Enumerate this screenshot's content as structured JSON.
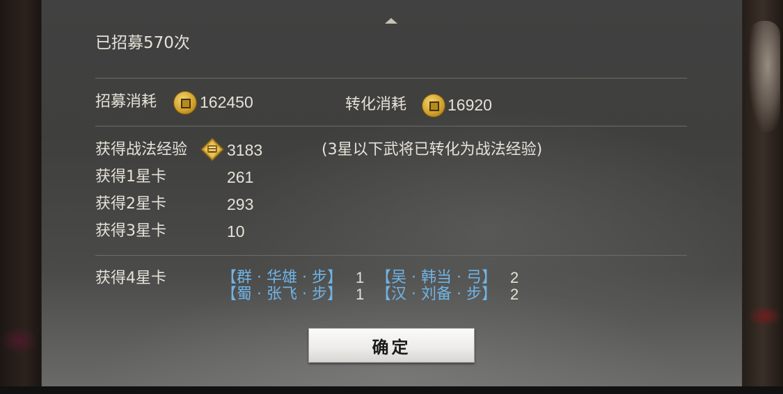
{
  "title": "已招募570次",
  "costs": {
    "recruit_label": "招募消耗",
    "recruit_value": "162450",
    "convert_label": "转化消耗",
    "convert_value": "16920",
    "currency_icon": "copper-coin-icon"
  },
  "rewards": {
    "exp_label": "获得战法经验",
    "exp_value": "3183",
    "exp_icon": "tactic-exp-icon",
    "exp_note": "(3星以下武将已转化为战法经验)",
    "star1_label": "获得1星卡",
    "star1_value": "261",
    "star2_label": "获得2星卡",
    "star2_value": "293",
    "star3_label": "获得3星卡",
    "star3_value": "10",
    "star4_label": "获得4星卡",
    "star4_cards": [
      {
        "name": "【群 · 华雄 · 步】",
        "count": "1"
      },
      {
        "name": "【吴 · 韩当 · 弓】",
        "count": "2"
      },
      {
        "name": "【蜀 · 张飞 · 步】",
        "count": "1"
      },
      {
        "name": "【汉 · 刘备 · 步】",
        "count": "2"
      }
    ]
  },
  "confirm_label": "确定",
  "colors": {
    "text": "#e6e2d8",
    "hero_link": "#6fb4e6",
    "panel": "#414141"
  }
}
